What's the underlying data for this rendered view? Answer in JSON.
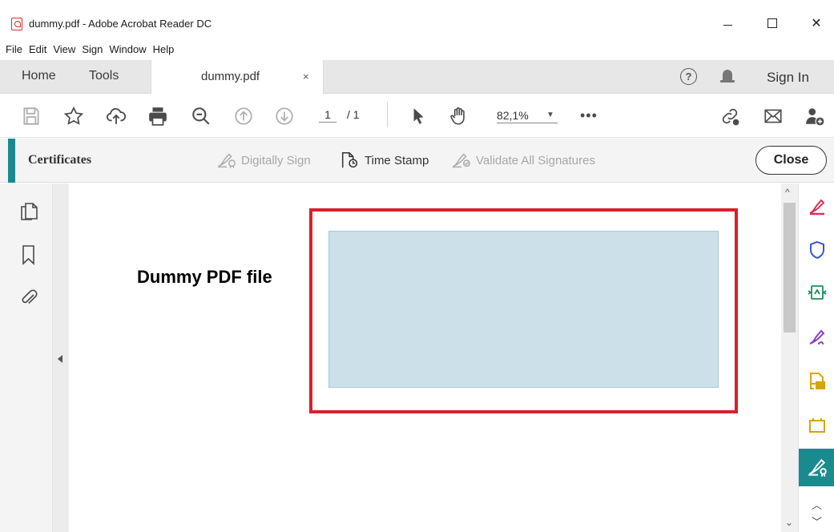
{
  "window": {
    "title": "dummy.pdf - Adobe Acrobat Reader DC",
    "close_glyph": "✕"
  },
  "menu": [
    "File",
    "Edit",
    "View",
    "Sign",
    "Window",
    "Help"
  ],
  "tabs": {
    "home": "Home",
    "tools": "Tools",
    "document": "dummy.pdf",
    "document_close": "×"
  },
  "header_right": {
    "help_glyph": "?",
    "sign_in": "Sign In"
  },
  "toolbar": {
    "page_current": "1",
    "page_total": "/ 1",
    "zoom": "82,1%",
    "zoom_caret": "▼",
    "more": "•••",
    "icons": [
      "save-icon",
      "bookmark-star-icon",
      "cloud-upload-icon",
      "print-icon",
      "zoom-out-icon",
      "page-up-icon",
      "page-down-icon",
      "select-pointer-icon",
      "hand-tool-icon",
      "share-link-icon",
      "email-icon",
      "add-user-icon"
    ]
  },
  "certificates": {
    "title": "Certificates",
    "digitally_sign": "Digitally Sign",
    "time_stamp": "Time Stamp",
    "validate": "Validate All Signatures",
    "close": "Close"
  },
  "left_panel": {
    "icons": [
      "page-thumbnails-icon",
      "bookmarks-icon",
      "attachments-icon"
    ]
  },
  "document": {
    "heading": "Dummy PDF file"
  },
  "scrollbar": {
    "up": "^",
    "down": "⌄"
  },
  "right_panel": {
    "icons": [
      "fill-sign-icon",
      "protect-icon",
      "export-pdf-icon",
      "sign-icon",
      "comment-icon",
      "stamp-icon",
      "certificates-icon"
    ],
    "chevron_up": "︿",
    "chevron_down": "﹀"
  },
  "colors": {
    "accent": "#1b8a8f",
    "signature_frame": "#d8202c",
    "signature_field": "#cce0ea"
  }
}
